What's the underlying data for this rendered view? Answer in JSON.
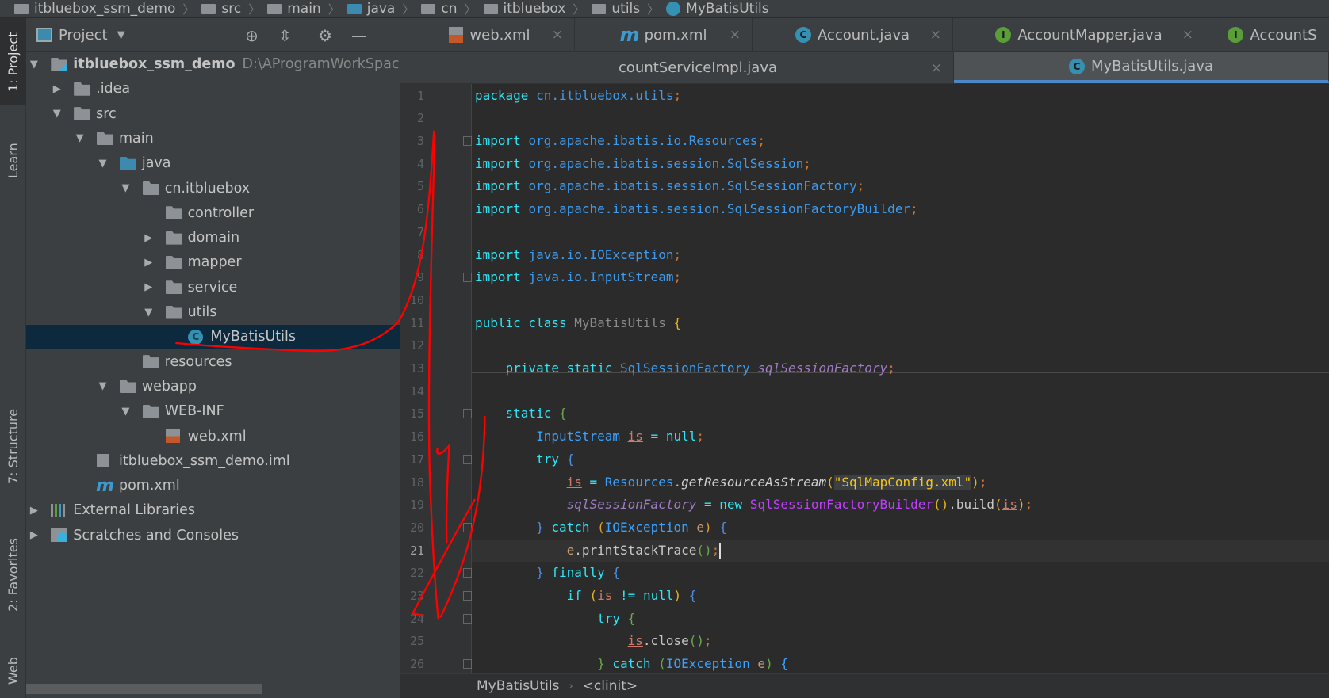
{
  "breadcrumb": [
    "itbluebox_ssm_demo",
    "src",
    "main",
    "java",
    "cn",
    "itbluebox",
    "utils",
    "MyBatisUtils"
  ],
  "tool_stripe": {
    "project": "1: Project",
    "learn": "Learn",
    "structure": "7: Structure",
    "favorites": "2: Favorites",
    "web": "Web"
  },
  "project_panel": {
    "title": "Project",
    "tree": [
      {
        "label": "itbluebox_ssm_demo",
        "level": 0,
        "arrow": "open",
        "icon": "module-icon",
        "bold": true,
        "path": "D:\\AProgramWorkSpace\\idea\\practice\\itbluebox_ssm_demo"
      },
      {
        "label": ".idea",
        "level": 1,
        "arrow": "closed",
        "icon": "folder-icon"
      },
      {
        "label": "src",
        "level": 1,
        "arrow": "open",
        "icon": "folder-icon"
      },
      {
        "label": "main",
        "level": 2,
        "arrow": "open",
        "icon": "folder-icon"
      },
      {
        "label": "java",
        "level": 3,
        "arrow": "open",
        "icon": "source-folder-icon"
      },
      {
        "label": "cn.itbluebox",
        "level": 4,
        "arrow": "open",
        "icon": "package-icon"
      },
      {
        "label": "controller",
        "level": 5,
        "arrow": "none",
        "icon": "package-icon"
      },
      {
        "label": "domain",
        "level": 5,
        "arrow": "closed",
        "icon": "package-icon"
      },
      {
        "label": "mapper",
        "level": 5,
        "arrow": "closed",
        "icon": "package-icon"
      },
      {
        "label": "service",
        "level": 5,
        "arrow": "closed",
        "icon": "package-icon"
      },
      {
        "label": "utils",
        "level": 5,
        "arrow": "open",
        "icon": "package-icon"
      },
      {
        "label": "MyBatisUtils",
        "level": 6,
        "arrow": "none",
        "icon": "class-icon",
        "selected": true
      },
      {
        "label": "resources",
        "level": 4,
        "arrow": "none",
        "icon": "resources-folder-icon"
      },
      {
        "label": "webapp",
        "level": 3,
        "arrow": "open",
        "icon": "web-folder-icon"
      },
      {
        "label": "WEB-INF",
        "level": 4,
        "arrow": "open",
        "icon": "folder-icon"
      },
      {
        "label": "web.xml",
        "level": 5,
        "arrow": "none",
        "icon": "xml-file-icon"
      },
      {
        "label": "itbluebox_ssm_demo.iml",
        "level": 2,
        "arrow": "none",
        "icon": "iml-file-icon"
      },
      {
        "label": "pom.xml",
        "level": 2,
        "arrow": "none",
        "icon": "maven-icon"
      },
      {
        "label": "External Libraries",
        "level": 0,
        "arrow": "closed",
        "icon": "libraries-icon"
      },
      {
        "label": "Scratches and Consoles",
        "level": 0,
        "arrow": "closed",
        "icon": "scratches-icon"
      }
    ]
  },
  "tabs_row1": [
    {
      "label": "web.xml",
      "icon": "xml-file-icon"
    },
    {
      "label": "pom.xml",
      "icon": "maven-icon"
    },
    {
      "label": "Account.java",
      "icon": "class-icon",
      "badge": "C",
      "badge_color": "#3591b3"
    },
    {
      "label": "AccountMapper.java",
      "icon": "interface-icon",
      "badge": "I",
      "badge_color": "#5a9e3a"
    },
    {
      "label": "AccountS",
      "icon": "interface-icon",
      "badge": "I",
      "badge_color": "#5a9e3a"
    }
  ],
  "tabs_row2": [
    {
      "label": "countServiceImpl.java"
    },
    {
      "label": "MyBatisUtils.java",
      "badge": "C",
      "badge_color": "#3591b3",
      "active": true
    }
  ],
  "close_glyph": "×",
  "current_line": 21,
  "code": [
    [
      [
        "package ",
        "k"
      ],
      [
        "cn.itbluebox.utils",
        "p"
      ],
      [
        ";",
        "s"
      ]
    ],
    [],
    [
      [
        "import ",
        "k"
      ],
      [
        "org.apache.ibatis.io.Resources",
        "p"
      ],
      [
        ";",
        "s"
      ]
    ],
    [
      [
        "import ",
        "k"
      ],
      [
        "org.apache.ibatis.session.SqlSession",
        "p"
      ],
      [
        ";",
        "s"
      ]
    ],
    [
      [
        "import ",
        "k"
      ],
      [
        "org.apache.ibatis.session.SqlSessionFactory",
        "p"
      ],
      [
        ";",
        "s"
      ]
    ],
    [
      [
        "import ",
        "k"
      ],
      [
        "org.apache.ibatis.session.SqlSessionFactoryBuilder",
        "p"
      ],
      [
        ";",
        "s"
      ]
    ],
    [],
    [
      [
        "import ",
        "k"
      ],
      [
        "java.io.IOException",
        "p"
      ],
      [
        ";",
        "s"
      ]
    ],
    [
      [
        "import ",
        "k"
      ],
      [
        "java.io.InputStream",
        "p"
      ],
      [
        ";",
        "s"
      ]
    ],
    [],
    [
      [
        "public class ",
        "k"
      ],
      [
        "MyBatisUtils ",
        "g"
      ],
      [
        "{",
        "y"
      ]
    ],
    [],
    [
      [
        "    private static ",
        "k"
      ],
      [
        "SqlSessionFactory ",
        "p"
      ],
      [
        "sqlSessionFactory",
        "f"
      ],
      [
        ";",
        "s"
      ]
    ],
    [],
    [
      [
        "    static ",
        "k"
      ],
      [
        "{",
        "gr"
      ]
    ],
    [
      [
        "        ",
        ""
      ],
      [
        "InputStream ",
        "t"
      ],
      [
        "is",
        "v"
      ],
      [
        " = null",
        "k"
      ],
      [
        ";",
        "s"
      ]
    ],
    [
      [
        "        try ",
        "k"
      ],
      [
        "{",
        "bb"
      ]
    ],
    [
      [
        "            ",
        ""
      ],
      [
        "is",
        "v"
      ],
      [
        " = ",
        "k"
      ],
      [
        "Resources",
        "t"
      ],
      [
        ".",
        "w"
      ],
      [
        "getResourceAsStream",
        "m"
      ],
      [
        "(",
        "y"
      ],
      [
        "\"SqlMapConfig.xml\"",
        "str"
      ],
      [
        ")",
        "y"
      ],
      [
        ";",
        "s"
      ]
    ],
    [
      [
        "            ",
        ""
      ],
      [
        "sqlSessionFactory",
        "f"
      ],
      [
        " = new ",
        "k"
      ],
      [
        "SqlSessionFactoryBuilder",
        "b"
      ],
      [
        "()",
        "y"
      ],
      [
        ".build",
        "w"
      ],
      [
        "(",
        "y"
      ],
      [
        "is",
        "v"
      ],
      [
        ")",
        "y"
      ],
      [
        ";",
        "s"
      ]
    ],
    [
      [
        "        ",
        ""
      ],
      [
        "} ",
        "bb"
      ],
      [
        "catch ",
        "k"
      ],
      [
        "(",
        "o"
      ],
      [
        "IOException",
        "t"
      ],
      [
        " e",
        "e"
      ],
      [
        ") ",
        "o"
      ],
      [
        "{",
        "bb"
      ]
    ],
    [
      [
        "            ",
        ""
      ],
      [
        "e",
        "e"
      ],
      [
        ".printStackTrace",
        "w"
      ],
      [
        "()",
        "gr"
      ],
      [
        ";",
        "s"
      ]
    ],
    [
      [
        "        ",
        ""
      ],
      [
        "} ",
        "bb"
      ],
      [
        "finally ",
        "k"
      ],
      [
        "{",
        "bb"
      ]
    ],
    [
      [
        "            if ",
        "k"
      ],
      [
        "(",
        "y"
      ],
      [
        "is",
        "v"
      ],
      [
        " != null",
        "k"
      ],
      [
        ") ",
        "y"
      ],
      [
        "{",
        "bb"
      ]
    ],
    [
      [
        "                try ",
        "k"
      ],
      [
        "{",
        "gr"
      ]
    ],
    [
      [
        "                    ",
        ""
      ],
      [
        "is",
        "v"
      ],
      [
        ".close",
        "w"
      ],
      [
        "()",
        "gr"
      ],
      [
        ";",
        "s"
      ]
    ],
    [
      [
        "                ",
        ""
      ],
      [
        "} ",
        "gr"
      ],
      [
        "catch ",
        "k"
      ],
      [
        "(",
        "gr"
      ],
      [
        "IOException",
        "t"
      ],
      [
        " e",
        "e"
      ],
      [
        ") ",
        "gr"
      ],
      [
        "{",
        "t"
      ]
    ]
  ],
  "status_breadcrumb": [
    "MyBatisUtils",
    "<clinit>"
  ],
  "annotation_color": "#ff0000"
}
